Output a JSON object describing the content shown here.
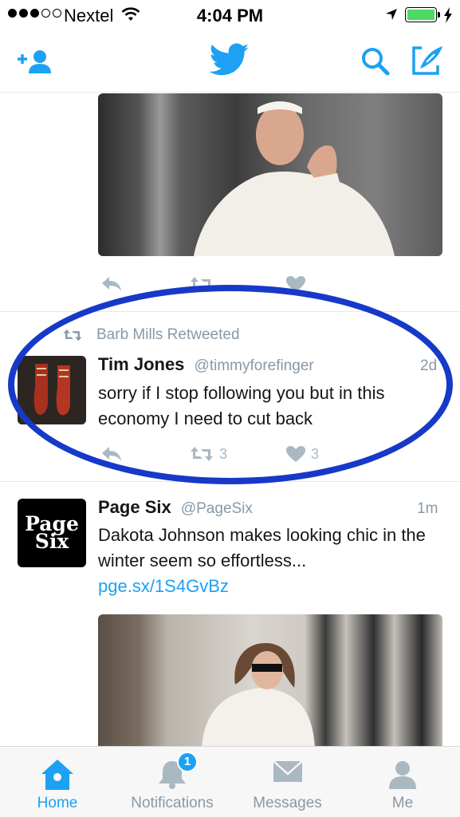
{
  "status_bar": {
    "carrier": "Nextel",
    "time": "4:04 PM",
    "battery_color": "#4cd964"
  },
  "nav": {
    "icons": [
      "add-user-icon",
      "twitter-bird-icon",
      "search-icon",
      "compose-icon"
    ],
    "accent": "#1da1f2"
  },
  "tweets": [
    {
      "has_photo": true,
      "photo_subject": "photo",
      "actions": [
        "reply",
        "retweet",
        "like"
      ]
    },
    {
      "retweet_context": "Barb Mills Retweeted",
      "name": "Tim Jones",
      "handle": "@timmyforefinger",
      "time": "2d",
      "text": "sorry if I stop following you but in this economy I need to cut back",
      "retweets": "3",
      "likes": "3",
      "highlighted": true
    },
    {
      "name": "Page Six",
      "handle": "@PageSix",
      "time": "1m",
      "avatar_text_line1": "Page",
      "avatar_text_line2": "Six",
      "text": "Dakota Johnson makes looking chic in the winter seem so effortless...",
      "link": "pge.sx/1S4GvBz",
      "has_photo": true
    }
  ],
  "tab_bar": {
    "tabs": [
      {
        "label": "Home",
        "icon": "home-icon",
        "active": true
      },
      {
        "label": "Notifications",
        "icon": "bell-icon",
        "badge": "1"
      },
      {
        "label": "Messages",
        "icon": "envelope-icon"
      },
      {
        "label": "Me",
        "icon": "person-icon"
      }
    ]
  }
}
